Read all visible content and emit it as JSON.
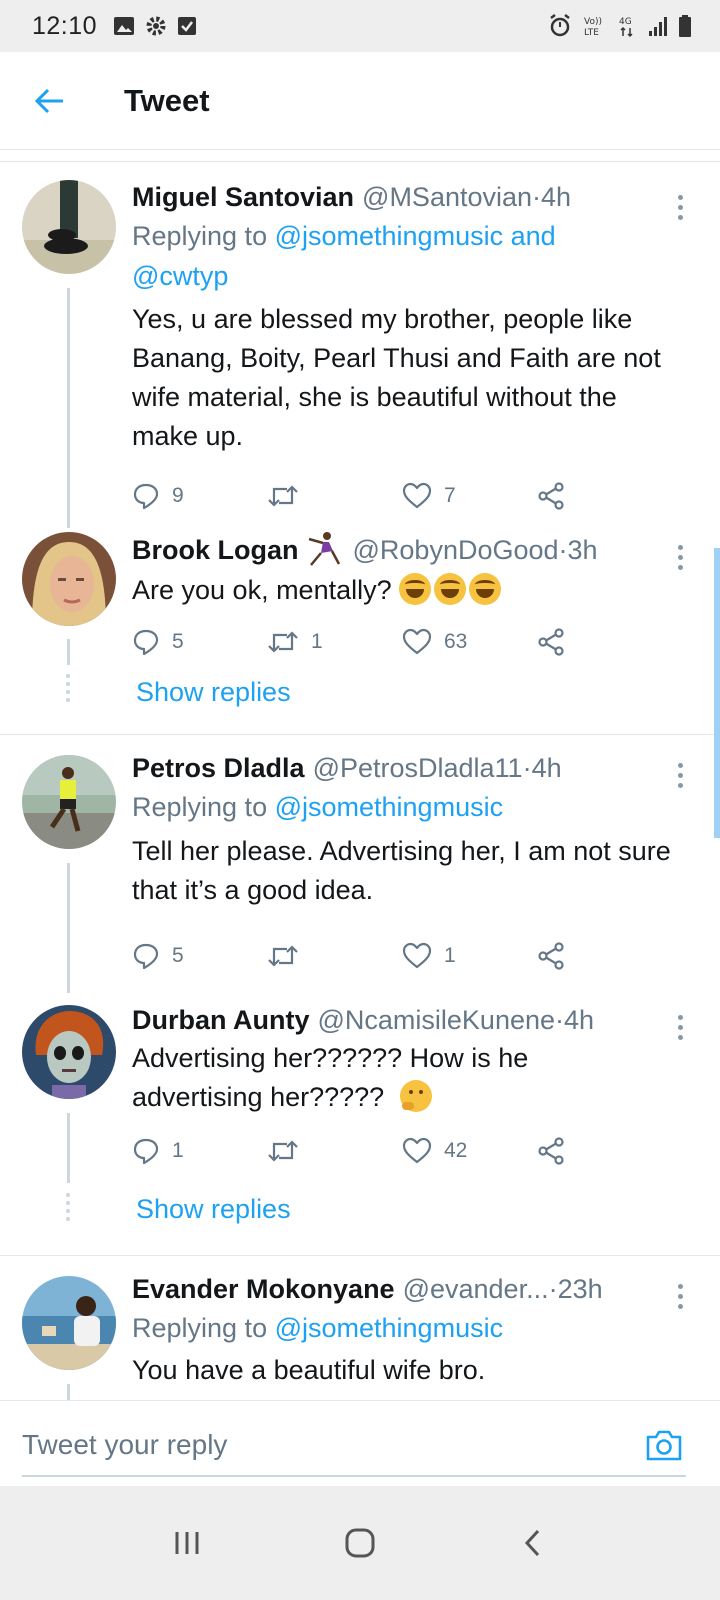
{
  "status_bar": {
    "time": "12:10"
  },
  "header": {
    "title": "Tweet"
  },
  "tweets": [
    {
      "name": "Miguel Santovian",
      "handle": "@MSantovian",
      "time": "4h",
      "reply_label": "Replying to ",
      "reply_mentions": "@jsomethingmusic and",
      "reply_mentions_2": "@cwtyp",
      "text": "Yes, u are blessed my brother, people like Banang, Boity, Pearl Thusi and Faith are not wife material, she is beautiful without the make up.",
      "replies": "9",
      "retweets": "",
      "likes": "7"
    },
    {
      "name": "Brook Logan",
      "handle": "@RobynDoGood",
      "time": "3h",
      "text": "Are you ok, mentally?",
      "replies": "5",
      "retweets": "1",
      "likes": "63",
      "show_replies": "Show replies"
    },
    {
      "name": "Petros Dladla",
      "handle": "@PetrosDladla11",
      "time": "4h",
      "reply_label": "Replying to ",
      "reply_mentions": "@jsomethingmusic",
      "text": "Tell her please. Advertising her, I am not sure that it’s a good idea.",
      "replies": "5",
      "retweets": "",
      "likes": "1"
    },
    {
      "name": "Durban Aunty",
      "handle": "@NcamisileKunene",
      "time": "4h",
      "text_line1": "Advertising her?????? How is he",
      "text_line2": "advertising her?????",
      "replies": "1",
      "retweets": "",
      "likes": "42",
      "show_replies": "Show replies"
    },
    {
      "name": "Evander Mokonyane",
      "handle": "@evander...",
      "time": "23h",
      "reply_label": "Replying to ",
      "reply_mentions": "@jsomethingmusic",
      "text": "You have a beautiful wife bro."
    }
  ],
  "separator": " · ",
  "reply_bar": {
    "placeholder": "Tweet your reply"
  },
  "colors": {
    "accent": "#1da1f2",
    "secondary_text": "#657786",
    "primary_text": "#14171a"
  }
}
